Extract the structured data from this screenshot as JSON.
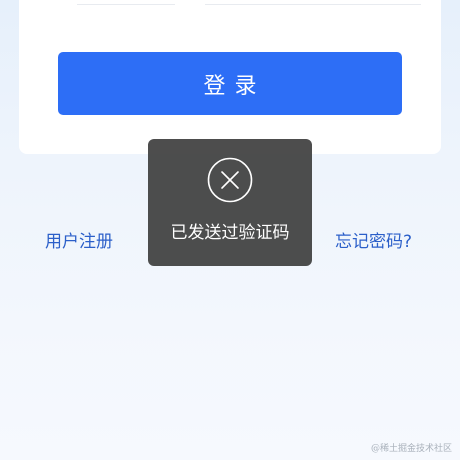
{
  "login_card": {
    "login_button_label": "登录"
  },
  "links": {
    "register": "用户注册",
    "forgot_password": "忘记密码?"
  },
  "toast": {
    "message": "已发送过验证码",
    "icon": "close-circle-icon"
  },
  "watermark": {
    "text": "@稀土掘金技术社区"
  },
  "colors": {
    "primary": "#2d6ef6",
    "link": "#2b5fc9",
    "toast_background": "#404040",
    "page_background": "#eef4fc"
  }
}
